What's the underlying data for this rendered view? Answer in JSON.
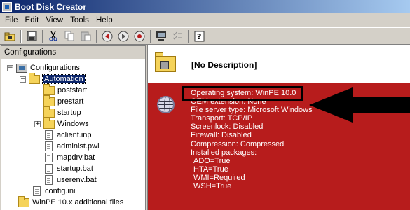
{
  "window": {
    "title": "Boot Disk Creator"
  },
  "menu": [
    "File",
    "Edit",
    "View",
    "Tools",
    "Help"
  ],
  "toolbar": {
    "buttons": [
      "open-folder-icon",
      "save-icon",
      "cut-icon",
      "copy-icon",
      "paste-icon",
      "back-icon",
      "forward-icon",
      "stop-icon",
      "computer-icon",
      "checklist-icon",
      "help-icon"
    ]
  },
  "left_pane": {
    "header": "Configurations",
    "tree": [
      {
        "label": "Configurations",
        "expander": "−",
        "icon": "root-icon"
      },
      {
        "label": "Automation",
        "expander": "−",
        "icon": "folder-disk-icon",
        "selected": true
      },
      {
        "label": "poststart",
        "icon": "folder-icon"
      },
      {
        "label": "prestart",
        "icon": "folder-icon"
      },
      {
        "label": "startup",
        "icon": "folder-icon"
      },
      {
        "label": "Windows",
        "expander": "+",
        "icon": "folder-icon"
      },
      {
        "label": "aclient.inp",
        "icon": "file-icon"
      },
      {
        "label": "administ.pwl",
        "icon": "file-icon"
      },
      {
        "label": "mapdrv.bat",
        "icon": "file-icon"
      },
      {
        "label": "startup.bat",
        "icon": "file-icon"
      },
      {
        "label": "userenv.bat",
        "icon": "file-icon"
      },
      {
        "label": "config.ini",
        "icon": "file-icon"
      },
      {
        "label": "WinPE 10.x additional files",
        "icon": "folder-icon"
      }
    ]
  },
  "right_pane": {
    "description": "[No Description]",
    "info": [
      "Operating system: WinPE 10.0",
      "OEM extension: None",
      "File server type: Microsoft Windows",
      "Transport: TCP/IP",
      "Screenlock: Disabled",
      "Firewall: Disabled",
      "Compression: Compressed",
      "Installed packages:",
      "ADO=True",
      "HTA=True",
      "WMI=Required",
      "WSH=True"
    ],
    "panel_color": "#b71c1c"
  }
}
